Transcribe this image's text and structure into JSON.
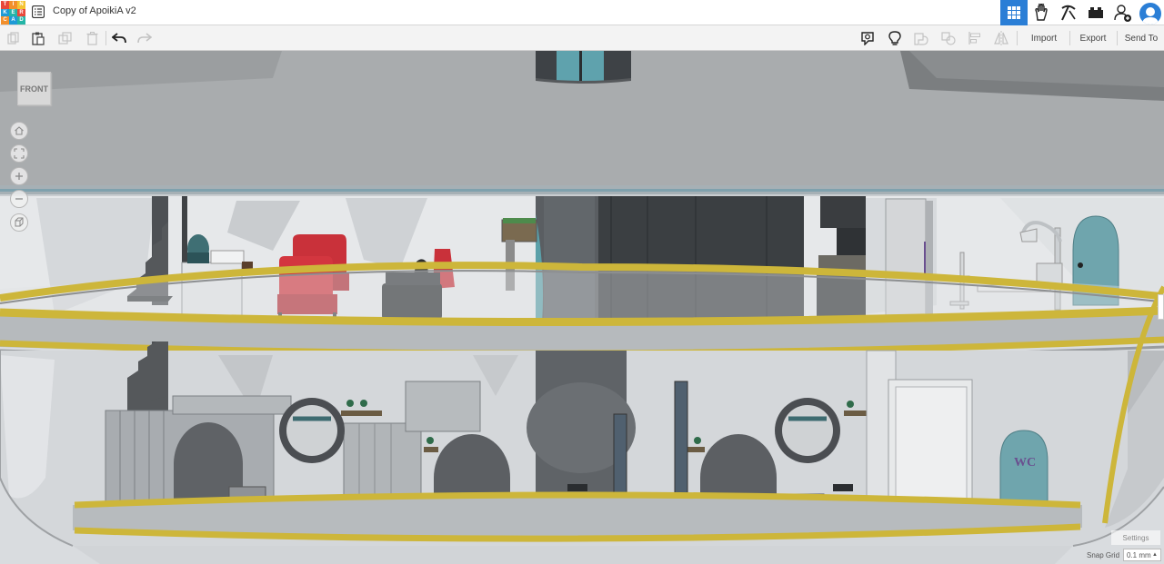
{
  "app": {
    "logo_letters": [
      "T",
      "I",
      "N",
      "K",
      "E",
      "R",
      "C",
      "A",
      "D"
    ],
    "logo_colors": [
      "#e8483b",
      "#f28f2c",
      "#f5c431",
      "#1e9ad6",
      "#24b5a7",
      "#e8483b",
      "#f28f2c",
      "#1e9ad6",
      "#24b5a7"
    ],
    "menu_icon": "list-icon",
    "title": "Copy of ApoikiA v2"
  },
  "header_icons": [
    {
      "name": "3d-design-grid-icon",
      "active": true
    },
    {
      "name": "circuits-hand-icon",
      "active": false
    },
    {
      "name": "codeblocks-pickaxe-icon",
      "active": false
    },
    {
      "name": "lego-brick-icon",
      "active": false
    },
    {
      "name": "add-user-icon",
      "active": false
    },
    {
      "name": "user-avatar-icon",
      "active": false
    }
  ],
  "toolbar": {
    "left_icons": [
      "copy-icon",
      "paste-icon",
      "duplicate-icon",
      "delete-icon",
      "undo-icon",
      "redo-icon"
    ],
    "right_icons": [
      "note-icon",
      "lightbulb-icon",
      "group-icon",
      "ungroup-icon",
      "align-icon",
      "mirror-icon"
    ],
    "import_label": "Import",
    "export_label": "Export",
    "send_to_label": "Send To"
  },
  "viewport": {
    "viewcube_label": "FRONT",
    "nav_icons": [
      "home-icon",
      "fit-view-icon",
      "zoom-in-icon",
      "zoom-out-icon",
      "perspective-icon"
    ],
    "wc_sign": "WC",
    "settings_label": "Settings",
    "snap_grid_label": "Snap Grid",
    "snap_grid_value": "0.1 mm"
  },
  "colors": {
    "accent_blue": "#2a7ed6",
    "floor_yellow": "#cdb63a",
    "teal_door": "#6fa5ad",
    "dark_shaft": "#4a4e52"
  }
}
